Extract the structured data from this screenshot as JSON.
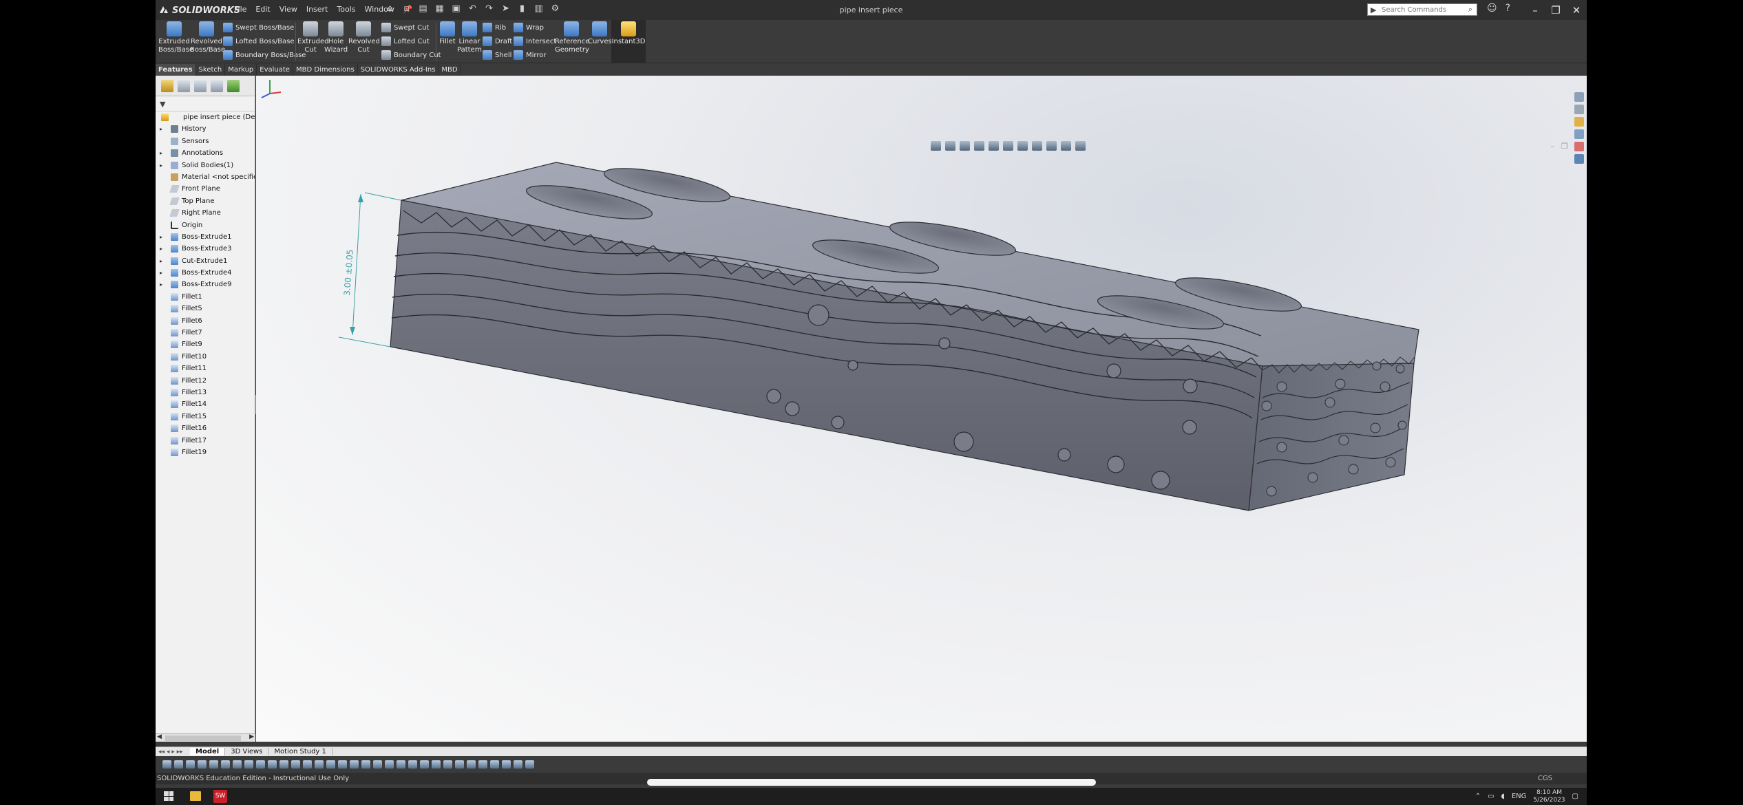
{
  "app": {
    "name": "SOLIDWORKS",
    "document_title": "pipe insert piece"
  },
  "menu": [
    "File",
    "Edit",
    "View",
    "Insert",
    "Tools",
    "Window"
  ],
  "search": {
    "placeholder": "Search Commands"
  },
  "ribbon": {
    "extruded_boss": "Extruded\nBoss/Base",
    "revolved_boss": "Revolved\nBoss/Base",
    "swept_boss": "Swept Boss/Base",
    "lofted_boss": "Lofted Boss/Base",
    "boundary_boss": "Boundary Boss/Base",
    "extruded_cut": "Extruded\nCut",
    "hole_wizard": "Hole\nWizard",
    "revolved_cut": "Revolved\nCut",
    "swept_cut": "Swept Cut",
    "lofted_cut": "Lofted Cut",
    "boundary_cut": "Boundary Cut",
    "fillet": "Fillet",
    "linear_pattern": "Linear\nPattern",
    "rib": "Rib",
    "draft": "Draft",
    "shell": "Shell",
    "wrap": "Wrap",
    "intersect": "Intersect",
    "mirror": "Mirror",
    "reference_geometry": "Reference\nGeometry",
    "curves": "Curves",
    "instant3d": "Instant3D"
  },
  "command_tabs": [
    "Features",
    "Sketch",
    "Markup",
    "Evaluate",
    "MBD Dimensions",
    "SOLIDWORKS Add-Ins",
    "MBD"
  ],
  "tree": [
    {
      "label": "pipe insert piece  (Default<",
      "icon": "part",
      "expand": ""
    },
    {
      "label": "History",
      "icon": "hist",
      "expand": "▸"
    },
    {
      "label": "Sensors",
      "icon": "sens",
      "expand": ""
    },
    {
      "label": "Annotations",
      "icon": "ann",
      "expand": "▸"
    },
    {
      "label": "Solid Bodies(1)",
      "icon": "solid",
      "expand": "▸"
    },
    {
      "label": "Material <not specified>",
      "icon": "mat",
      "expand": ""
    },
    {
      "label": "Front Plane",
      "icon": "plane",
      "expand": ""
    },
    {
      "label": "Top Plane",
      "icon": "plane",
      "expand": ""
    },
    {
      "label": "Right Plane",
      "icon": "plane",
      "expand": ""
    },
    {
      "label": "Origin",
      "icon": "origin",
      "expand": ""
    },
    {
      "label": "Boss-Extrude1",
      "icon": "feat",
      "expand": "▸"
    },
    {
      "label": "Boss-Extrude3",
      "icon": "feat",
      "expand": "▸"
    },
    {
      "label": "Cut-Extrude1",
      "icon": "feat",
      "expand": "▸"
    },
    {
      "label": "Boss-Extrude4",
      "icon": "feat",
      "expand": "▸"
    },
    {
      "label": "Boss-Extrude9",
      "icon": "feat",
      "expand": "▸"
    },
    {
      "label": "Fillet1",
      "icon": "fillet",
      "expand": ""
    },
    {
      "label": "Fillet5",
      "icon": "fillet",
      "expand": ""
    },
    {
      "label": "Fillet6",
      "icon": "fillet",
      "expand": ""
    },
    {
      "label": "Fillet7",
      "icon": "fillet",
      "expand": ""
    },
    {
      "label": "Fillet9",
      "icon": "fillet",
      "expand": ""
    },
    {
      "label": "Fillet10",
      "icon": "fillet",
      "expand": ""
    },
    {
      "label": "Fillet11",
      "icon": "fillet",
      "expand": ""
    },
    {
      "label": "Fillet12",
      "icon": "fillet",
      "expand": ""
    },
    {
      "label": "Fillet13",
      "icon": "fillet",
      "expand": ""
    },
    {
      "label": "Fillet14",
      "icon": "fillet",
      "expand": ""
    },
    {
      "label": "Fillet15",
      "icon": "fillet",
      "expand": ""
    },
    {
      "label": "Fillet16",
      "icon": "fillet",
      "expand": ""
    },
    {
      "label": "Fillet17",
      "icon": "fillet",
      "expand": ""
    },
    {
      "label": "Fillet19",
      "icon": "fillet",
      "expand": ""
    }
  ],
  "dimension": {
    "text": "3.00 ±0.05"
  },
  "bottom_tabs": [
    "Model",
    "3D Views",
    "Motion Study 1"
  ],
  "status": {
    "text": "SOLIDWORKS Education Edition - Instructional Use Only",
    "units": "CGS"
  },
  "taskbar": {
    "lang": "ENG",
    "time": "8:10 AM",
    "date": "5/26/2023"
  },
  "colors": {
    "app_bg": "#3b3b3b",
    "viewport_bg": "#ecedf0",
    "model_top": "#9a9daa",
    "model_front": "#6c6e79"
  }
}
